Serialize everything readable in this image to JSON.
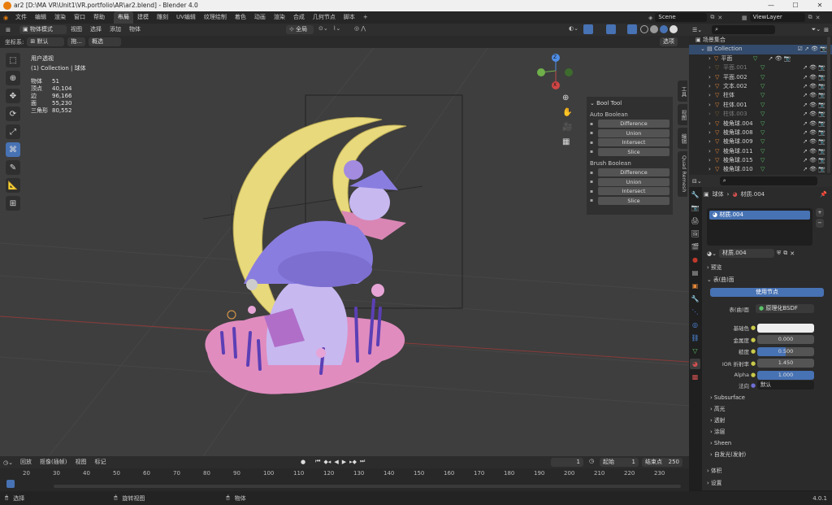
{
  "window": {
    "title": "ar2 [D:\\MA VR\\Unit1\\VR.portfolio\\AR\\ar2.blend] - Blender 4.0"
  },
  "menu": [
    "文件",
    "编辑",
    "渲染",
    "窗口",
    "帮助"
  ],
  "workspaces": [
    "布局",
    "建模",
    "雕刻",
    "UV编辑",
    "纹理绘制",
    "着色",
    "动画",
    "渲染",
    "合成",
    "几何节点",
    "脚本"
  ],
  "workspace_add": "+",
  "scene": {
    "label": "Scene",
    "viewlayer": "ViewLayer"
  },
  "view_header": {
    "mode": "物体模式",
    "menus": [
      "视图",
      "选择",
      "添加",
      "物体"
    ],
    "orientation": "全局",
    "options": "选项"
  },
  "view_header2": {
    "coord_label": "坐标系:",
    "coord_value": "默认",
    "drag_label": "拖...",
    "select_mode": "概选"
  },
  "overlay": {
    "view_name": "用户透视",
    "collection": "(1) Collection | 球体",
    "stats": [
      {
        "k": "物体",
        "v": "51"
      },
      {
        "k": "顶点",
        "v": "40,104"
      },
      {
        "k": "边",
        "v": "96,166"
      },
      {
        "k": "面",
        "v": "55,230"
      },
      {
        "k": "三角形",
        "v": "80,552"
      }
    ]
  },
  "gizmo": {
    "z": "Z",
    "y": "Y",
    "x": "X"
  },
  "bool_panel": {
    "title": "Bool Tool",
    "auto_label": "Auto Boolean",
    "brush_label": "Brush Boolean",
    "auto": [
      "Difference",
      "Union",
      "Intersect",
      "Slice"
    ],
    "brush": [
      "Difference",
      "Union",
      "Intersect",
      "Slice"
    ]
  },
  "side_tabs": [
    "工具",
    "视图",
    "编辑",
    "Quad Remesh"
  ],
  "outliner": {
    "root": "场景集合",
    "collection": "Collection",
    "items": [
      {
        "n": "平面",
        "dim": false
      },
      {
        "n": "平面.001",
        "dim": true
      },
      {
        "n": "平面.002",
        "dim": false
      },
      {
        "n": "文本.002",
        "dim": false
      },
      {
        "n": "柱体",
        "dim": false
      },
      {
        "n": "柱体.001",
        "dim": false
      },
      {
        "n": "柱体.003",
        "dim": true
      },
      {
        "n": "棱角球.004",
        "dim": false
      },
      {
        "n": "棱角球.008",
        "dim": false
      },
      {
        "n": "棱角球.009",
        "dim": false
      },
      {
        "n": "棱角球.011",
        "dim": false
      },
      {
        "n": "棱角球.015",
        "dim": false
      },
      {
        "n": "棱角球.010",
        "dim": false
      }
    ]
  },
  "properties": {
    "breadcrumb_obj": "球体",
    "breadcrumb_mat": "材质.004",
    "slot": "材质.004",
    "mat_name": "材质.004",
    "preview": "预览",
    "surface": "表(曲)面",
    "use_nodes": "使用节点",
    "surface_label": "表(曲)面",
    "surface_value": "原理化BSDF",
    "fields": [
      {
        "k": "基础色",
        "v": "",
        "kind": "color"
      },
      {
        "k": "金属度",
        "v": "0.000",
        "fill": 0
      },
      {
        "k": "糙度",
        "v": "0.500",
        "fill": 0.5
      },
      {
        "k": "IOR 折射率",
        "v": "1.450",
        "fill": 0
      },
      {
        "k": "Alpha",
        "v": "1.000",
        "fill": 1
      }
    ],
    "normal_label": "法向",
    "normal_value": "默认",
    "subsections": [
      "Subsurface",
      "高光",
      "透射",
      "涂层",
      "Sheen",
      "自发光(发射)"
    ],
    "volume": "体积",
    "settings": "设置"
  },
  "timeline": {
    "menus": [
      "回放",
      "抠像(插帧)",
      "视图",
      "标记"
    ],
    "current": "1",
    "start_label": "起始",
    "start": "1",
    "end_label": "结束点",
    "end": "250",
    "ticks": [
      "20",
      "30",
      "40",
      "50",
      "60",
      "70",
      "80",
      "90",
      "100",
      "110",
      "120",
      "130",
      "140",
      "150",
      "160",
      "170",
      "180",
      "190",
      "200",
      "210",
      "220",
      "230"
    ]
  },
  "status": {
    "select": "选择",
    "rotate": "旋转视图",
    "object": "物体",
    "version": "4.0.1"
  },
  "colors": {
    "accent": "#4772b3",
    "logo": "#e87d0d",
    "moon": "#e8d97c",
    "ghost": "#c7b8f0",
    "hat": "#8a7de0",
    "pink": "#e08cbf"
  }
}
